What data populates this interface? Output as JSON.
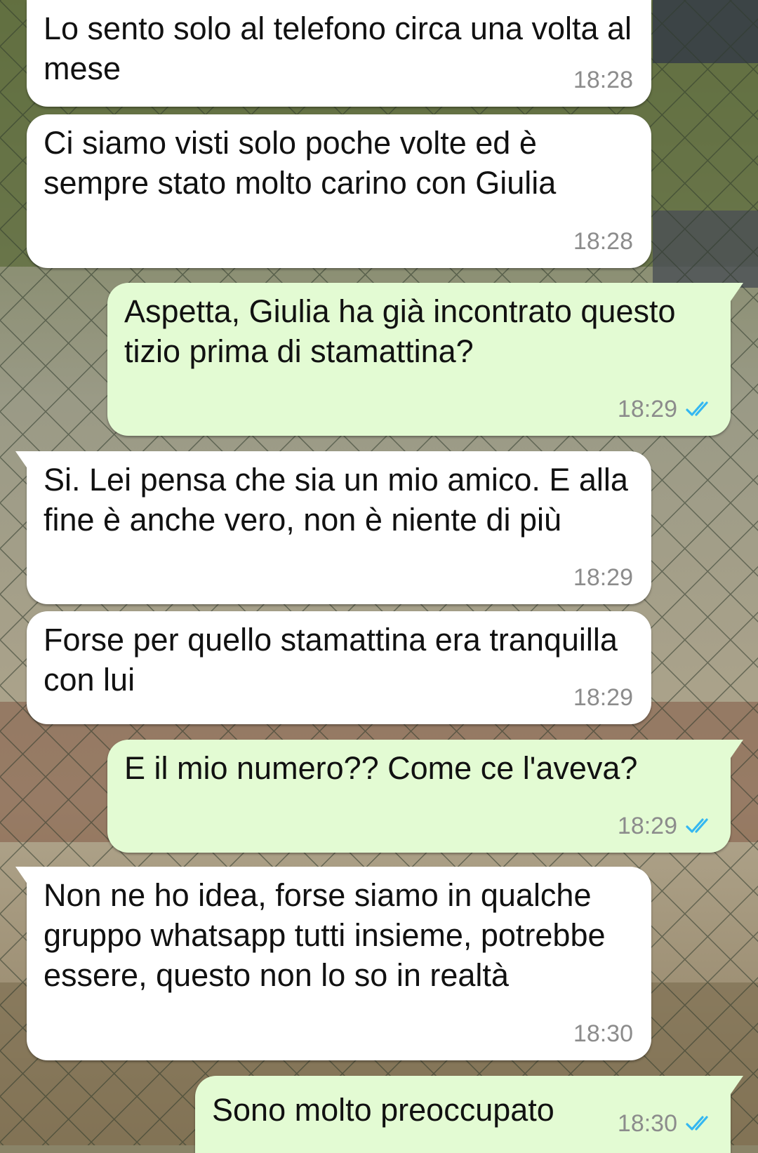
{
  "theme": {
    "incoming_bg": "#ffffff",
    "outgoing_bg": "#e3fbd3",
    "text_color": "#111111",
    "time_color": "#8c8c8c",
    "read_tick_color": "#34b7f1"
  },
  "messages": [
    {
      "direction": "incoming",
      "text": "Lo sento solo al telefono circa una volta al mese",
      "time": "18:28"
    },
    {
      "direction": "incoming",
      "text": "Ci siamo visti solo poche volte ed è sempre stato molto carino con Giulia",
      "time": "18:28"
    },
    {
      "direction": "outgoing",
      "text": "Aspetta, Giulia ha già incontrato questo tizio prima di stamattina?",
      "time": "18:29",
      "status_icon": "double-check-read-icon"
    },
    {
      "direction": "incoming",
      "text": "Si. Lei pensa che sia un mio amico. E alla fine è anche vero, non è niente di più",
      "time": "18:29"
    },
    {
      "direction": "incoming",
      "text": "Forse per quello stamattina era tranquilla con lui",
      "time": "18:29"
    },
    {
      "direction": "outgoing",
      "text": "E il mio numero?? Come ce l'aveva?",
      "time": "18:29",
      "status_icon": "double-check-read-icon"
    },
    {
      "direction": "incoming",
      "text": "Non ne ho idea, forse siamo in qualche gruppo whatsapp tutti insieme, potrebbe essere, questo non lo so in realtà",
      "time": "18:30"
    },
    {
      "direction": "outgoing",
      "text": "Sono molto preoccupato",
      "time": "18:30",
      "status_icon": "double-check-read-icon"
    }
  ]
}
